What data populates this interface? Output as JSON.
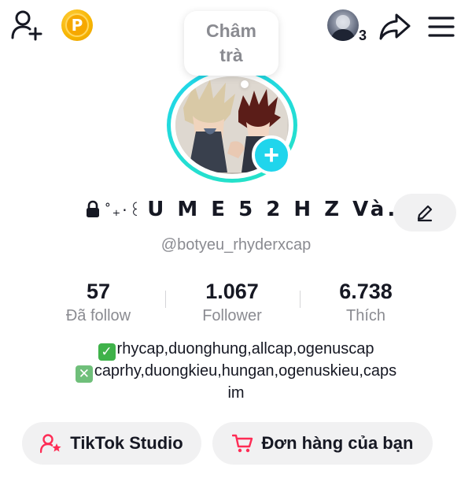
{
  "topbar": {
    "add_friend_icon": "person-add-icon",
    "coin_icon": "coin-p-icon",
    "coin_letter": "P",
    "story_count": "3",
    "share_icon": "share-arrow-icon",
    "menu_icon": "hamburger-menu-icon"
  },
  "note": {
    "line1": "Châm",
    "line2": "trà"
  },
  "profile": {
    "name_decoration": "˚₊‧꒰",
    "name": "U M E 5 2 H Z Và...",
    "name_badge": "3",
    "username": "@botyeu_rhyderxcap"
  },
  "stats": [
    {
      "value": "57",
      "label": "Đã follow"
    },
    {
      "value": "1.067",
      "label": "Follower"
    },
    {
      "value": "6.738",
      "label": "Thích"
    }
  ],
  "bio": {
    "line1_mark": "✓",
    "line1": "rhycap,duonghung,allcap,ogenuscap",
    "line2_mark": "✕",
    "line2": "caprhy,duongkieu,hungan,ogenuskieu,caps",
    "line3": "im"
  },
  "actions": {
    "studio_label": "TikTok Studio",
    "orders_label": "Đơn hàng của bạn"
  },
  "colors": {
    "accent_cyan": "#20d5ec",
    "badge_red": "#fe2c55",
    "studio_icon": "#fe2c55",
    "orders_icon": "#fe2c55"
  }
}
